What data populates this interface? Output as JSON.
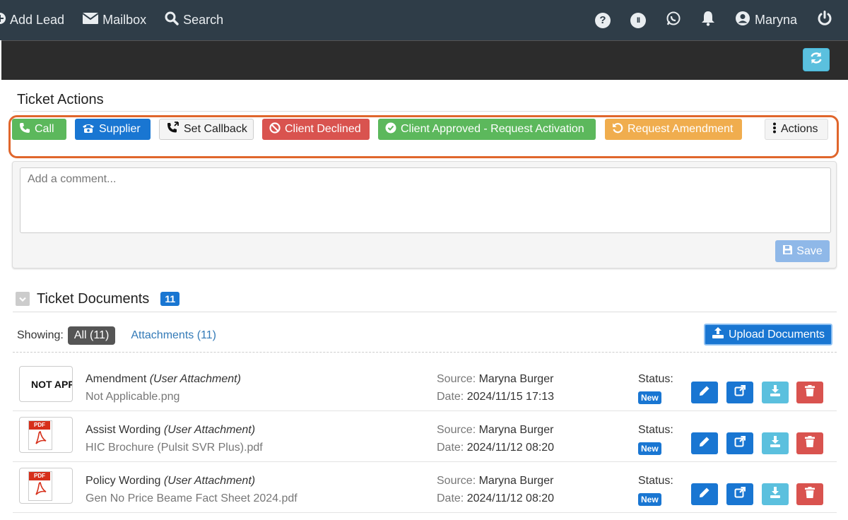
{
  "nav": {
    "add_lead": "Add Lead",
    "mailbox": "Mailbox",
    "search": "Search",
    "help_glyph": "?",
    "pause_glyph": "II",
    "user": "Maryna"
  },
  "ticket_actions": {
    "title": "Ticket Actions",
    "buttons": {
      "call": "Call",
      "supplier": "Supplier",
      "set_callback": "Set Callback",
      "client_declined": "Client Declined",
      "client_approved": "Client Approved - Request Activation",
      "request_amendment": "Request Amendment",
      "actions": "Actions"
    }
  },
  "comment": {
    "placeholder": "Add a comment...",
    "save_label": "Save"
  },
  "documents": {
    "title": "Ticket Documents",
    "count": "11",
    "showing_label": "Showing:",
    "filter_all": "All (11)",
    "filter_attachments": "Attachments (11)",
    "upload_label": "Upload Documents",
    "source_label": "Source:",
    "date_label": "Date:",
    "status_label": "Status:",
    "pdf_tag": "PDF",
    "rows": [
      {
        "thumb_text": "NOT APP",
        "name": "Amendment",
        "kind": "(User Attachment)",
        "file": "Not Applicable.png",
        "source": "Maryna Burger",
        "date": "2024/11/15 17:13",
        "status": "New"
      },
      {
        "thumb_text": "",
        "name": "Assist Wording",
        "kind": "(User Attachment)",
        "file": "HIC Brochure (Pulsit SVR Plus).pdf",
        "source": "Maryna Burger",
        "date": "2024/11/12 08:20",
        "status": "New"
      },
      {
        "thumb_text": "",
        "name": "Policy Wording",
        "kind": "(User Attachment)",
        "file": "Gen No Price Beame Fact Sheet 2024.pdf",
        "source": "Maryna Burger",
        "date": "2024/11/12 08:20",
        "status": "New"
      }
    ]
  },
  "colors": {
    "navbar": "#2f3d48",
    "success": "#5cb85c",
    "primary": "#1976d2",
    "danger": "#d9534f",
    "warning": "#f0ad4e",
    "info": "#5bc0de",
    "highlight": "#e0662c"
  }
}
